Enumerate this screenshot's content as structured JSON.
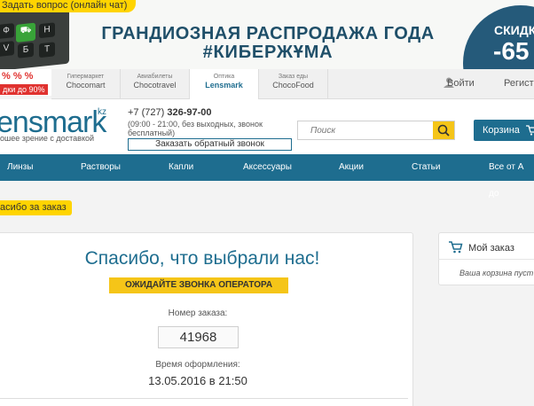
{
  "banner": {
    "ask_label": "Задать вопрос (онлайн чат)",
    "pct": "% % %",
    "mini_sale": "дки до 90%",
    "title": "ГРАНДИОЗНАЯ РАСПРОДАЖА ГОДА",
    "hashtag": "#КИБЕРЖҰМА",
    "sale_label": "СКИДКИ",
    "sale_value": "-65"
  },
  "services": [
    {
      "caption": "Гипермаркет",
      "name": "Chocomart"
    },
    {
      "caption": "Авиабилеты",
      "name": "Chocotravel"
    },
    {
      "caption": "Оптика",
      "name": "Lensmark"
    },
    {
      "caption": "Заказ еды",
      "name": "ChocoFood"
    }
  ],
  "account": {
    "login": "Войти",
    "register": "Регистр"
  },
  "header": {
    "logo_main": "ensmark",
    "logo_kz": "kz",
    "tagline": "ошее зрение с доставкой",
    "phone_prefix": "+7 (727)",
    "phone_number": "326-97-00",
    "hours": "(09:00 - 21:00, без выходных, звонок бесплатный)",
    "callback": "Заказать обратный звонок",
    "search_placeholder": "Поиск",
    "cart": "Корзина"
  },
  "nav": [
    "Линзы",
    "Растворы",
    "Капли",
    "Аксессуары",
    "Акции",
    "Статьи",
    "Все от А до"
  ],
  "breadcrumb": "асибо за заказ",
  "order": {
    "thanks": "Спасибо, что выбрали нас!",
    "status": "ОЖИДАЙТЕ ЗВОНКА ОПЕРАТОРА",
    "number_label": "Номер заказа:",
    "number": "41968",
    "time_label": "Время оформления:",
    "time": "13.05.2016 в 21:50"
  },
  "sidebar": {
    "title": "Мой заказ",
    "empty": "Ваша корзина пуст"
  }
}
